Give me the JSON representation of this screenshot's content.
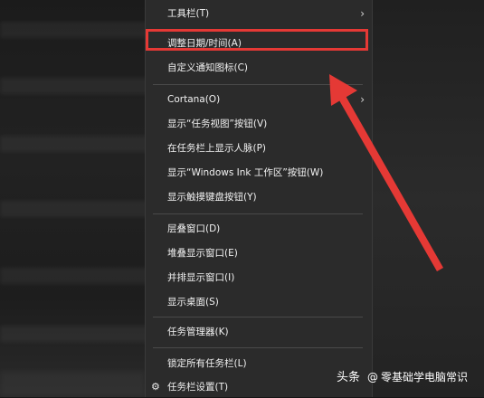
{
  "menu": {
    "items": [
      {
        "label": "工具栏(T)",
        "has_submenu": true
      },
      {
        "label": "调整日期/时间(A)",
        "has_submenu": false,
        "highlighted": true
      },
      {
        "label": "自定义通知图标(C)",
        "has_submenu": false
      },
      {
        "label": "Cortana(O)",
        "has_submenu": true
      },
      {
        "label": "显示“任务视图”按钮(V)",
        "has_submenu": false
      },
      {
        "label": "在任务栏上显示人脉(P)",
        "has_submenu": false
      },
      {
        "label": "显示“Windows Ink 工作区”按钮(W)",
        "has_submenu": false
      },
      {
        "label": "显示触摸键盘按钮(Y)",
        "has_submenu": false
      },
      {
        "label": "层叠窗口(D)",
        "has_submenu": false
      },
      {
        "label": "堆叠显示窗口(E)",
        "has_submenu": false
      },
      {
        "label": "并排显示窗口(I)",
        "has_submenu": false
      },
      {
        "label": "显示桌面(S)",
        "has_submenu": false
      },
      {
        "label": "任务管理器(K)",
        "has_submenu": false
      },
      {
        "label": "锁定所有任务栏(L)",
        "has_submenu": false
      },
      {
        "label": "任务栏设置(T)",
        "has_submenu": false,
        "icon": "gear-icon"
      }
    ]
  },
  "annotation": {
    "highlight_color": "#e53935"
  },
  "watermark": {
    "brand": "头条",
    "at": "@",
    "account": "零基础学电脑常识"
  },
  "icons": {
    "submenu": "chevron-right-icon",
    "settings": "gear-icon"
  }
}
